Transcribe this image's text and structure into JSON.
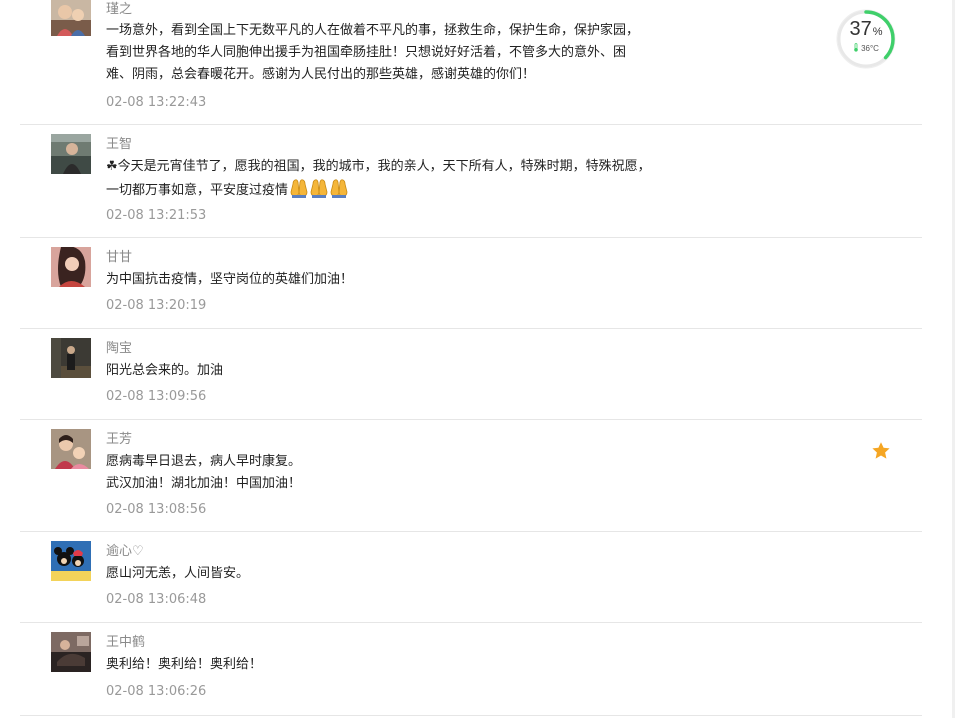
{
  "comments": [
    {
      "author": "瑾之",
      "lines": [
        "一场意外，看到全国上下无数平凡的人在做着不平凡的事，拯救生命，保护生命，保护家园，",
        "看到世界各地的华人同胞伸出援手为祖国牵肠挂肚！只想说好好活着，不管多大的意外、困",
        "难、阴雨，总会春暖花开。感谢为人民付出的那些英雄，感谢英雄的你们！"
      ],
      "time": "02-08 13:22:43"
    },
    {
      "author": "王智",
      "lines": [
        "☘今天是元宵佳节了，愿我的祖国，我的城市，我的亲人，天下所有人，特殊时期，特殊祝愿，",
        "一切都万事如意，平安度过疫情"
      ],
      "time": "02-08 13:21:53"
    },
    {
      "author": "甘甘",
      "lines": [
        "为中国抗击疫情，坚守岗位的英雄们加油！"
      ],
      "time": "02-08 13:20:19"
    },
    {
      "author": "陶宝",
      "lines": [
        "阳光总会来的。加油"
      ],
      "time": "02-08 13:09:56"
    },
    {
      "author": "王芳",
      "lines": [
        "愿病毒早日退去，病人早时康复。",
        "武汉加油！湖北加油！中国加油！"
      ],
      "time": "02-08 13:08:56"
    },
    {
      "author": "逾心♡",
      "lines": [
        "愿山河无恙，人间皆安。"
      ],
      "time": "02-08 13:06:48"
    },
    {
      "author": "王中鹤",
      "lines": [
        "奥利给！奥利给！奥利给！"
      ],
      "time": "02-08 13:06:26"
    }
  ],
  "gauge": {
    "percent": "37",
    "percent_unit": "%",
    "level": 0.37,
    "temperature": "36°C",
    "ring_color": "#3fcf6a",
    "track_color": "#e8e8e8"
  },
  "icons": {
    "pray": "folded-hands-icon",
    "star": "star-icon",
    "thermometer": "thermometer-icon"
  },
  "colors": {
    "star": "#f5a623",
    "author": "#8a8a8a",
    "timestamp": "#999999",
    "divider": "#e6e6e6"
  }
}
